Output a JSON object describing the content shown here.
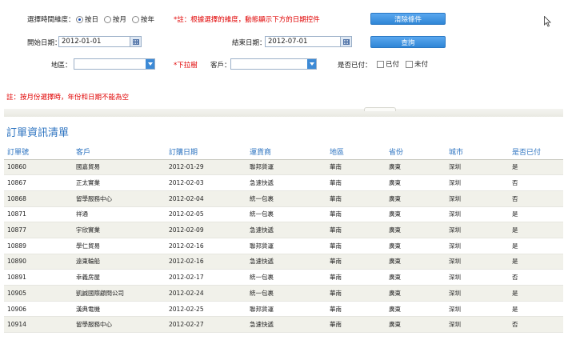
{
  "filters": {
    "granularity_label": "選擇時間維度：",
    "radio_day": "按日",
    "radio_month": "按月",
    "radio_year": "按年",
    "granularity_note": "*註：根據選擇的維度，動態顯示下方的日期控件",
    "clear_button": "清除條件",
    "start_label": "開始日期：",
    "start_value": "2012-01-01",
    "end_label": "結束日期：",
    "end_value": "2012-07-01",
    "query_button": "查詢",
    "region_label": "地區：",
    "region_value": "",
    "dropdown_note": "*下拉樹",
    "customer_label": "客戶：",
    "customer_value": "",
    "paid_label": "是否已付：",
    "paid_yes": "已付",
    "paid_no": "未付",
    "month_note": "註：按月份選擇時，年份和日期不能為空"
  },
  "list": {
    "title": "訂單資訊清單",
    "columns": [
      "訂單號",
      "客戶",
      "訂購日期",
      "運貨商",
      "地區",
      "省份",
      "城市",
      "是否已付"
    ],
    "rows": [
      [
        "10860",
        "國嘉貿易",
        "2012-01-29",
        "聯邦貨運",
        "華南",
        "廣東",
        "深圳",
        "是"
      ],
      [
        "10867",
        "正太實業",
        "2012-02-03",
        "急速快遞",
        "華南",
        "廣東",
        "深圳",
        "否"
      ],
      [
        "10868",
        "留學服務中心",
        "2012-02-04",
        "統一包裹",
        "華南",
        "廣東",
        "深圳",
        "否"
      ],
      [
        "10871",
        "祥通",
        "2012-02-05",
        "統一包裹",
        "華南",
        "廣東",
        "深圳",
        "是"
      ],
      [
        "10877",
        "宇欣實業",
        "2012-02-09",
        "急速快遞",
        "華南",
        "廣東",
        "深圳",
        "是"
      ],
      [
        "10889",
        "學仁貿易",
        "2012-02-16",
        "聯邦貨運",
        "華南",
        "廣東",
        "深圳",
        "是"
      ],
      [
        "10890",
        "遠東輪船",
        "2012-02-16",
        "急速快遞",
        "華南",
        "廣東",
        "深圳",
        "是"
      ],
      [
        "10891",
        "幸義房屋",
        "2012-02-17",
        "統一包裹",
        "華南",
        "廣東",
        "深圳",
        "否"
      ],
      [
        "10905",
        "凱誠國際顧問公司",
        "2012-02-24",
        "統一包裹",
        "華南",
        "廣東",
        "深圳",
        "是"
      ],
      [
        "10906",
        "漢典電機",
        "2012-02-25",
        "聯邦貨運",
        "華南",
        "廣東",
        "深圳",
        "是"
      ],
      [
        "10914",
        "留學服務中心",
        "2012-02-27",
        "急速快遞",
        "華南",
        "廣東",
        "深圳",
        "否"
      ]
    ]
  },
  "colors": {
    "accent": "#2c73c0",
    "note": "#e00000",
    "button": "#3d8ad6"
  },
  "icons": {
    "calendar": "calendar-icon",
    "dropdown": "chevron-down-icon",
    "cursor": "mouse-cursor-icon"
  }
}
